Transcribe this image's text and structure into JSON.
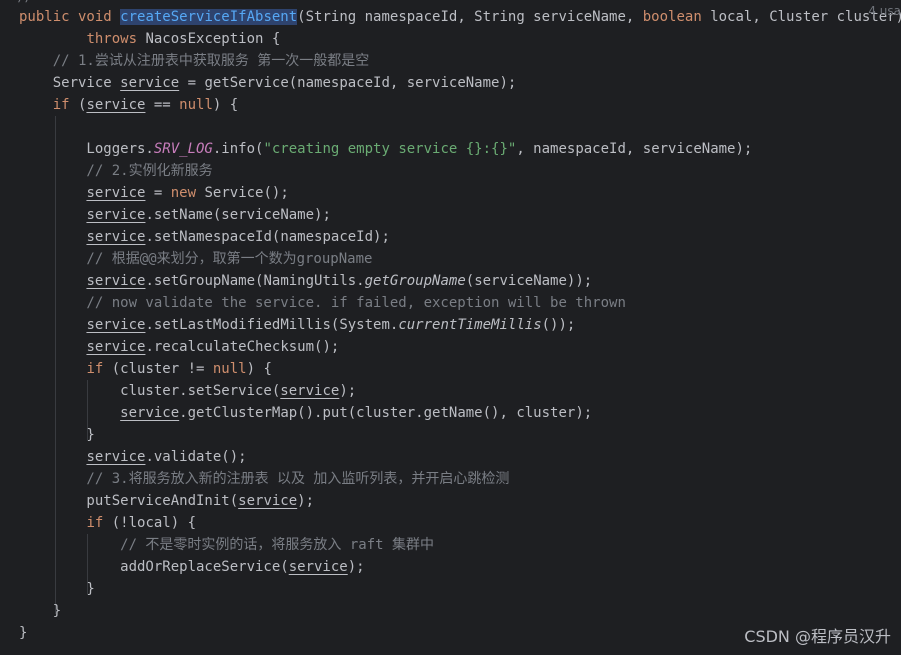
{
  "editor": {
    "top_comment": "//",
    "inlay_usages": "4 usa",
    "lines": [
      [
        {
          "t": "public void ",
          "c": "kw"
        },
        {
          "t": "createServiceIfAbsent",
          "c": "fnhl"
        },
        {
          "t": "(String namespaceId, String serviceName, ",
          "c": "plain"
        },
        {
          "t": "boolean",
          "c": "kw"
        },
        {
          "t": " local, Cluster cluster)",
          "c": "plain"
        }
      ],
      [
        {
          "t": "        ",
          "c": "plain"
        },
        {
          "t": "throws",
          "c": "kw"
        },
        {
          "t": " NacosException {",
          "c": "plain"
        }
      ],
      [
        {
          "t": "    // 1.尝试从注册表中获取服务 第一次一般都是空",
          "c": "cmt"
        }
      ],
      [
        {
          "t": "    Service ",
          "c": "plain"
        },
        {
          "t": "service",
          "c": "var"
        },
        {
          "t": " = getService(namespaceId, serviceName);",
          "c": "plain"
        }
      ],
      [
        {
          "t": "    ",
          "c": "plain"
        },
        {
          "t": "if",
          "c": "kw"
        },
        {
          "t": " (",
          "c": "plain"
        },
        {
          "t": "service",
          "c": "var"
        },
        {
          "t": " == ",
          "c": "plain"
        },
        {
          "t": "null",
          "c": "kw"
        },
        {
          "t": ") {",
          "c": "plain"
        }
      ],
      [
        {
          "t": "",
          "c": "plain"
        }
      ],
      [
        {
          "t": "        Loggers.",
          "c": "plain"
        },
        {
          "t": "SRV_LOG",
          "c": "field"
        },
        {
          "t": ".info(",
          "c": "plain"
        },
        {
          "t": "\"creating empty service {}:{}\"",
          "c": "str"
        },
        {
          "t": ", namespaceId, serviceName);",
          "c": "plain"
        }
      ],
      [
        {
          "t": "        // 2.实例化新服务",
          "c": "cmt"
        }
      ],
      [
        {
          "t": "        ",
          "c": "plain"
        },
        {
          "t": "service",
          "c": "var"
        },
        {
          "t": " = ",
          "c": "plain"
        },
        {
          "t": "new",
          "c": "kw"
        },
        {
          "t": " Service();",
          "c": "plain"
        }
      ],
      [
        {
          "t": "        ",
          "c": "plain"
        },
        {
          "t": "service",
          "c": "var"
        },
        {
          "t": ".setName(serviceName);",
          "c": "plain"
        }
      ],
      [
        {
          "t": "        ",
          "c": "plain"
        },
        {
          "t": "service",
          "c": "var"
        },
        {
          "t": ".setNamespaceId(namespaceId);",
          "c": "plain"
        }
      ],
      [
        {
          "t": "        // 根据@@来划分，取第一个数为groupName",
          "c": "cmt"
        }
      ],
      [
        {
          "t": "        ",
          "c": "plain"
        },
        {
          "t": "service",
          "c": "var"
        },
        {
          "t": ".setGroupName(NamingUtils.",
          "c": "plain"
        },
        {
          "t": "getGroupName",
          "c": "italic"
        },
        {
          "t": "(serviceName));",
          "c": "plain"
        }
      ],
      [
        {
          "t": "        // now validate the service. if failed, exception will be thrown",
          "c": "cmt"
        }
      ],
      [
        {
          "t": "        ",
          "c": "plain"
        },
        {
          "t": "service",
          "c": "var"
        },
        {
          "t": ".setLastModifiedMillis(System.",
          "c": "plain"
        },
        {
          "t": "currentTimeMillis",
          "c": "italic"
        },
        {
          "t": "());",
          "c": "plain"
        }
      ],
      [
        {
          "t": "        ",
          "c": "plain"
        },
        {
          "t": "service",
          "c": "var"
        },
        {
          "t": ".recalculateChecksum();",
          "c": "plain"
        }
      ],
      [
        {
          "t": "        ",
          "c": "plain"
        },
        {
          "t": "if",
          "c": "kw"
        },
        {
          "t": " (cluster != ",
          "c": "plain"
        },
        {
          "t": "null",
          "c": "kw"
        },
        {
          "t": ") {",
          "c": "plain"
        }
      ],
      [
        {
          "t": "            cluster.setService(",
          "c": "plain"
        },
        {
          "t": "service",
          "c": "var"
        },
        {
          "t": ");",
          "c": "plain"
        }
      ],
      [
        {
          "t": "            ",
          "c": "plain"
        },
        {
          "t": "service",
          "c": "var"
        },
        {
          "t": ".getClusterMap().put(cluster.getName(), cluster);",
          "c": "plain"
        }
      ],
      [
        {
          "t": "        }",
          "c": "plain"
        }
      ],
      [
        {
          "t": "        ",
          "c": "plain"
        },
        {
          "t": "service",
          "c": "var"
        },
        {
          "t": ".validate();",
          "c": "plain"
        }
      ],
      [
        {
          "t": "        // 3.将服务放入新的注册表 以及 加入监听列表，并开启心跳检测",
          "c": "cmt"
        }
      ],
      [
        {
          "t": "        putServiceAndInit(",
          "c": "plain"
        },
        {
          "t": "service",
          "c": "var"
        },
        {
          "t": ");",
          "c": "plain"
        }
      ],
      [
        {
          "t": "        ",
          "c": "plain"
        },
        {
          "t": "if",
          "c": "kw"
        },
        {
          "t": " (!local) {",
          "c": "plain"
        }
      ],
      [
        {
          "t": "            // 不是零时实例的话，将服务放入 raft 集群中",
          "c": "cmt"
        }
      ],
      [
        {
          "t": "            addOrReplaceService(",
          "c": "plain"
        },
        {
          "t": "service",
          "c": "var"
        },
        {
          "t": ");",
          "c": "plain"
        }
      ],
      [
        {
          "t": "        }",
          "c": "plain"
        }
      ],
      [
        {
          "t": "    }",
          "c": "plain"
        }
      ],
      [
        {
          "t": "}",
          "c": "plain"
        }
      ]
    ]
  },
  "watermark": "CSDN @程序员汉升"
}
